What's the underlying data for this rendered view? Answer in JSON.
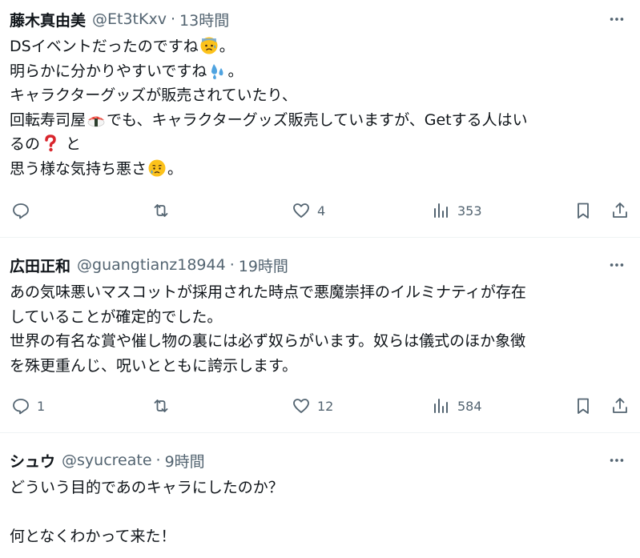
{
  "posts": [
    {
      "name": "藤木真由美",
      "handle": "@Et3tKxv",
      "sep": "·",
      "time": "13時間",
      "lines": [
        [
          "DSイベントだったのですね",
          "。"
        ],
        [
          "明らかに分かりやすいですね",
          "。"
        ],
        [
          "キャラクターグッズが販売されていたり、"
        ],
        [
          "回転寿司屋",
          "でも、キャラクターグッズ販売していますが、Getする人はい"
        ],
        [
          "るの",
          " と"
        ],
        [
          "思う様な気持ち悪さ",
          "。"
        ]
      ],
      "emojis": [
        "anxious-sweat-face",
        "sweat-droplets",
        "sushi",
        "red-question-mark",
        "sad-relieved-face"
      ],
      "replies": "",
      "likes": "4",
      "views": "353"
    },
    {
      "name": "広田正和",
      "handle": "@guangtianz18944",
      "sep": "·",
      "time": "19時間",
      "lines": [
        [
          "あの気味悪いマスコットが採用された時点で悪魔崇拝のイルミナティが存在"
        ],
        [
          "していることが確定的でした。"
        ],
        [
          "世界の有名な賞や催し物の裏には必ず奴らがいます。奴らは儀式のほか象徴"
        ],
        [
          "を殊更重んじ、呪いとともに誇示します。"
        ]
      ],
      "replies": "1",
      "likes": "12",
      "views": "584"
    },
    {
      "name": "シュウ",
      "handle": "@syucreate",
      "sep": "·",
      "time": "9時間",
      "lines": [
        [
          "どういう目的であのキャラにしたのか？"
        ],
        [
          ""
        ],
        [
          "何となくわかって来た！"
        ]
      ]
    }
  ],
  "colors": {
    "text": "#0f1419",
    "secondary": "#536471",
    "divider": "#eff3f4"
  }
}
